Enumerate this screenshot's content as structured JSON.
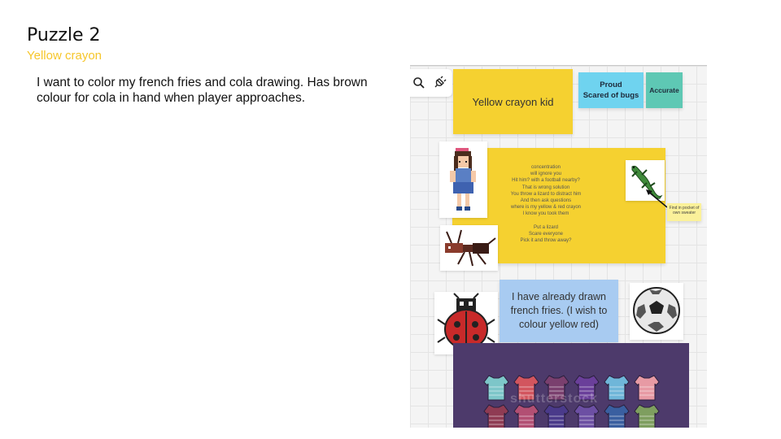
{
  "slide": {
    "title": "Puzzle 2",
    "subtitle": "Yellow crayon",
    "body": "I want to color my french fries and cola drawing. Has brown colour for cola in hand when player approaches."
  },
  "board": {
    "toolbar": {
      "search_icon": "search-icon",
      "plug_icon": "plug-icon"
    },
    "stickies": {
      "kid": "Yellow crayon kid",
      "proud": "Proud",
      "scared": "Scared of bugs",
      "accurate": "Accurate",
      "find": "Find in pocket of own sweater",
      "fries": "I have already drawn french fries. (I wish to colour yellow red)"
    },
    "big_note_lines": [
      "concentration",
      "will ignore you",
      "Hit him? with a football nearby?",
      "That is wrong solution",
      "You throw a lizard to distract him",
      "And then ask questions",
      "where is my yellow & red crayon",
      "I know you took them",
      "",
      "Put a lizard",
      "Scare everyone",
      "Pick it and throw away?"
    ],
    "sweater_colors": [
      "#7dc6c9",
      "#d2555e",
      "#7a3f6e",
      "#6a3f9a",
      "#6fb6d9",
      "#e79aa4",
      "#8f3b53",
      "#b24f73",
      "#4a3a8a",
      "#6c4fa3",
      "#3a5fa0",
      "#7e9e5f"
    ]
  },
  "colors": {
    "subtitle": "#f6c62a",
    "sticky_yellow": "#f5d130",
    "sticky_blue": "#6fd3ef",
    "sticky_teal": "#5ec8b4",
    "sticky_light_blue": "#a8cbf1",
    "sweater_bg": "#4d3a6b"
  }
}
